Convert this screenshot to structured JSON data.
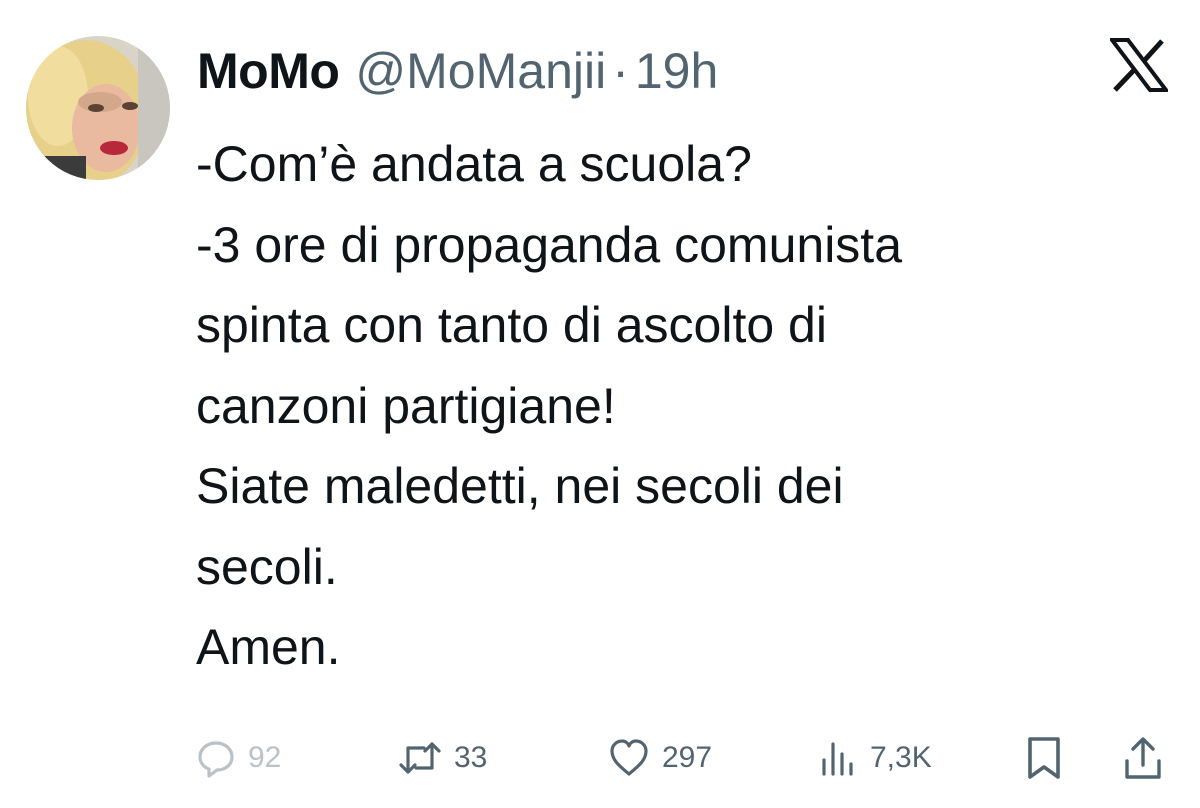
{
  "author": {
    "display_name": "MoMo",
    "handle": "@MoManjii",
    "separator": "·",
    "time": "19h"
  },
  "platform_icon": "x-logo-icon",
  "tweet_lines": [
    "-Com’è andata a scuola?",
    "-3 ore di propaganda comunista",
    "spinta con tanto di ascolto di",
    "canzoni partigiane!",
    "Siate maledetti, nei secoli dei",
    "secoli.",
    "Amen."
  ],
  "actions": {
    "reply": {
      "icon": "reply-icon",
      "count": "92"
    },
    "retweet": {
      "icon": "retweet-icon",
      "count": "33"
    },
    "like": {
      "icon": "heart-icon",
      "count": "297"
    },
    "views": {
      "icon": "views-icon",
      "count": "7,3K"
    },
    "bookmark": {
      "icon": "bookmark-icon"
    },
    "share": {
      "icon": "share-icon"
    }
  },
  "colors": {
    "text": "#0f1419",
    "secondary": "#536471",
    "muted": "#b9c2c9",
    "background": "#ffffff"
  }
}
